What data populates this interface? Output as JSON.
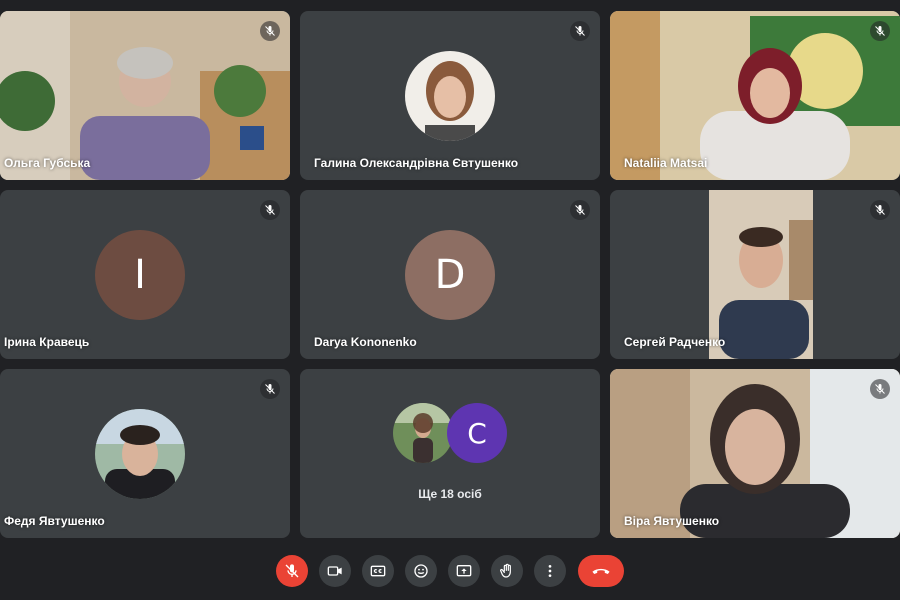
{
  "participants": [
    {
      "name": "Ольга Губська",
      "muted": true,
      "mode": "video"
    },
    {
      "name": "Галина Олександрівна Євтушенко",
      "muted": true,
      "mode": "photo"
    },
    {
      "name": "Nataliia Matsai",
      "muted": true,
      "mode": "video"
    },
    {
      "name": "Ірина Кравець",
      "muted": true,
      "mode": "letter",
      "initial": "I",
      "avatar_color": "#6d4c41"
    },
    {
      "name": "Darya Kononenko",
      "muted": true,
      "mode": "letter",
      "initial": "D",
      "avatar_color": "#8d6e63"
    },
    {
      "name": "Сергей Радченко",
      "muted": true,
      "mode": "video"
    },
    {
      "name": "Федя Явтушенко",
      "muted": true,
      "mode": "photo"
    },
    {
      "name": "Віра Явтушенко",
      "muted": true,
      "mode": "video"
    }
  ],
  "overflow_tile": {
    "label": "Ще 18 осіб",
    "initial": "C",
    "avatar_color": "#5e35b1"
  },
  "toolbar": {
    "buttons": [
      "mic-off",
      "camera",
      "captions",
      "emoji",
      "present",
      "raise-hand",
      "more",
      "leave-call"
    ]
  },
  "colors": {
    "background": "#202124",
    "tile": "#3c4043",
    "danger": "#ea4335"
  }
}
